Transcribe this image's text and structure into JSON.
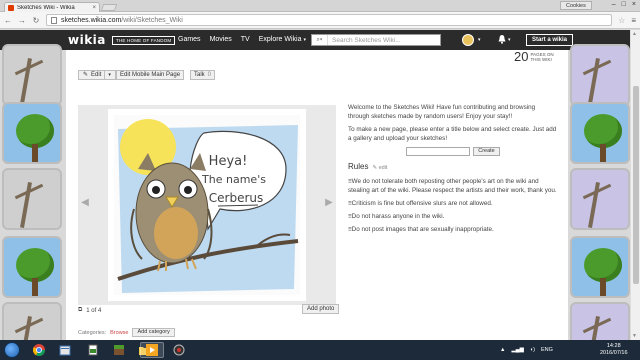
{
  "browser": {
    "tab_title": "Sketches Wiki - Wikia",
    "tab_close": "×",
    "cookies_label": "Cookies",
    "window_buttons": [
      "–",
      "□",
      "×"
    ],
    "url_domain": "sketches.wikia.com",
    "url_path": "/wiki/Sketches_Wiki",
    "back_glyph": "←",
    "forward_glyph": "→",
    "reload_glyph": "↻",
    "star_glyph": "☆",
    "menu_glyph": "≡"
  },
  "wikia": {
    "logo": "wikia",
    "home_of_fandom": "THE HOME OF FANDOM",
    "nav": [
      "Games",
      "Movies",
      "TV",
      "Explore Wikia"
    ],
    "explore_caret": "▾",
    "search_placeholder": "Search Sketches Wiki...",
    "search_icon": "search-icon",
    "start_wiki_label": "Start a wikia",
    "bell_glyph": "🔔",
    "caret": "▾"
  },
  "page": {
    "edit_label": "Edit",
    "edit_mobile_label": "Edit Mobile Main Page",
    "talk_label": "Talk",
    "talk_count": "0",
    "pages_count": "20",
    "pages_label": "PAGES ON THIS WIKI",
    "slide_prev": "◀",
    "slide_next": "▶",
    "slide_counter": "1 of 4",
    "add_photo": "Add photo",
    "welcome_text": "Welcome to the Sketches Wiki! Have fun contributing and browsing through sketches made by random users! Enjoy your stay!!",
    "make_page_text": "To make a new page, please enter a title below and select create. Just add a gallery and upload your sketches!",
    "create_label": "Create",
    "rules_title": "Rules",
    "rules_edit": "edit",
    "rules": [
      "≡We do not tolerate both reposting other people's art on the wiki and stealing art of the wiki. Please respect the artists and their work, thank you.",
      "≡Criticism is fine but offensive slurs are not allowed.",
      "≡Do not harass anyone in the wiki.",
      "≡Do not post images that are sexually inappropriate."
    ],
    "categories_label": "Categories:",
    "browse_label": "Browse",
    "add_category": "Add category"
  },
  "owl_speech": [
    "Heya!",
    "The name's",
    "Cerberus"
  ],
  "taskbar": {
    "apps": [
      "chrome-icon",
      "file-explorer-icon",
      "document-icon",
      "minecraft-icon",
      "folder-icon",
      "media-player-icon",
      "app-icon"
    ],
    "tray_lang": "ENG",
    "time": "14:28",
    "date": "2016/07/16"
  },
  "colors": {
    "wikia_bar": "#2b2b2b",
    "taskbar": "#1c2a3a",
    "link": "#c44"
  }
}
